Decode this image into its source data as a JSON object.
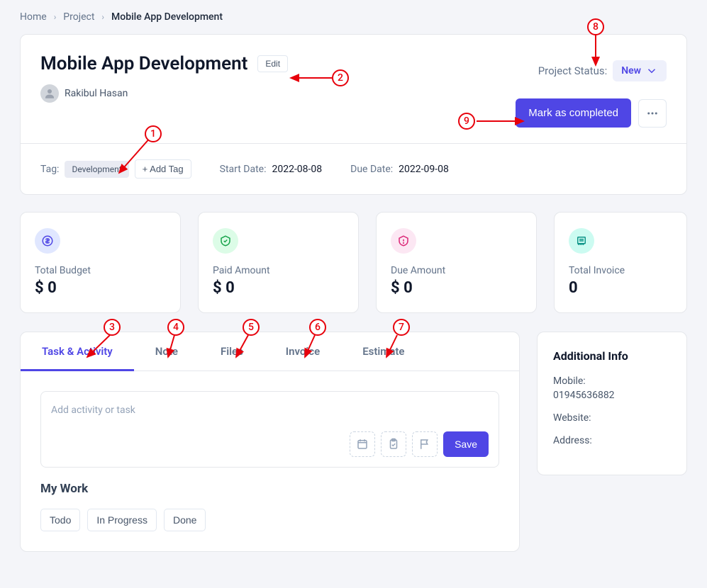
{
  "breadcrumb": {
    "home": "Home",
    "project": "Project",
    "current": "Mobile App Development"
  },
  "header": {
    "title": "Mobile App Development",
    "edit_label": "Edit",
    "owner_name": "Rakibul Hasan",
    "status_label": "Project Status:",
    "status_value": "New",
    "mark_complete_label": "Mark as completed"
  },
  "meta": {
    "tag_label": "Tag:",
    "tag_value": "Development",
    "add_tag_label": "+ Add Tag",
    "start_label": "Start Date:",
    "start_value": "2022-08-08",
    "due_label": "Due Date:",
    "due_value": "2022-09-08"
  },
  "stats": {
    "budget_label": "Total Budget",
    "budget_value": "$ 0",
    "paid_label": "Paid Amount",
    "paid_value": "$ 0",
    "due_label": "Due Amount",
    "due_value": "$ 0",
    "invoice_label": "Total Invoice",
    "invoice_value": "0"
  },
  "tabs": {
    "task": "Task & Activity",
    "note": "Note",
    "files": "Files",
    "invoice": "Invoice",
    "estimate": "Estimate"
  },
  "activity": {
    "placeholder": "Add activity or task",
    "save_label": "Save"
  },
  "mywork": {
    "title": "My Work",
    "todo": "Todo",
    "in_progress": "In Progress",
    "done": "Done"
  },
  "info": {
    "title": "Additional Info",
    "mobile_label": "Mobile:",
    "mobile_value": "01945636882",
    "website_label": "Website:",
    "website_value": "",
    "address_label": "Address:",
    "address_value": ""
  },
  "annotations": {
    "1": "1",
    "2": "2",
    "3": "3",
    "4": "4",
    "5": "5",
    "6": "6",
    "7": "7",
    "8": "8",
    "9": "9"
  }
}
